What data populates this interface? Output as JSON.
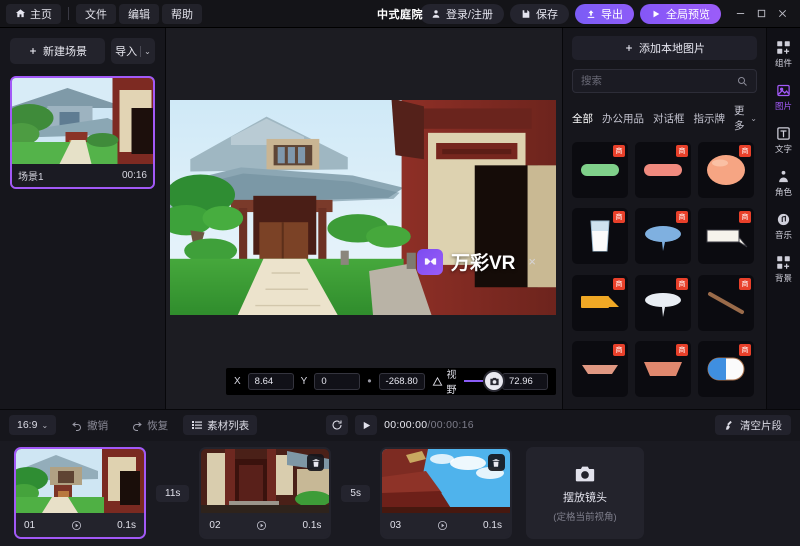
{
  "topbar": {
    "home": "主页",
    "menus": [
      "文件",
      "编辑",
      "帮助"
    ],
    "doc_title": "中式庭院",
    "login": "登录/注册",
    "save": "保存",
    "export": "导出",
    "preview": "全局预览",
    "accent": "#8b5cf6"
  },
  "scenes": {
    "new_scene": "新建场景",
    "import": "导入",
    "items": [
      {
        "name": "场景1",
        "duration": "00:16",
        "selected": true
      }
    ]
  },
  "stage": {
    "watermark": {
      "text": "万彩VR",
      "close": "×",
      "logo": "vr-logo-icon"
    },
    "transform": {
      "x_label": "X",
      "x_value": "8.64",
      "y_label": "Y",
      "y_value": "0",
      "z_value": "-268.80",
      "fov_label": "视野",
      "fov_value": "72.96"
    }
  },
  "assets": {
    "add_local": "添加本地图片",
    "search_placeholder": "搜索",
    "filters": [
      "全部",
      "办公用品",
      "对话框",
      "指示牌"
    ],
    "filter_active": "全部",
    "more": "更多",
    "badge_label": "商",
    "tiles": [
      {
        "shape": "green-rounded-bar",
        "color": "#7fd08a",
        "premium": true
      },
      {
        "shape": "salmon-rounded-bar",
        "color": "#f08a7e",
        "premium": true
      },
      {
        "shape": "peach-balloon",
        "color": "#f6a583",
        "premium": true
      },
      {
        "shape": "milk-glass",
        "color": "#f4f4f6",
        "premium": true
      },
      {
        "shape": "blue-speech-ellipse",
        "color": "#7fb0e0",
        "premium": true
      },
      {
        "shape": "white-rect-callout",
        "color": "#f6f3ec",
        "premium": true
      },
      {
        "shape": "orange-flag-callout",
        "color": "#f0a825",
        "premium": true
      },
      {
        "shape": "white-speech-ellipse",
        "color": "#e9eef4",
        "premium": true
      },
      {
        "shape": "brown-stick",
        "color": "#9a6b4a",
        "premium": true
      },
      {
        "shape": "salmon-trapezoid-thin",
        "color": "#e09882",
        "premium": true
      },
      {
        "shape": "salmon-trapezoid-thick",
        "color": "#e0886e",
        "premium": true
      },
      {
        "shape": "blue-white-capsule",
        "color": "#3f8fe0",
        "premium": true
      }
    ]
  },
  "rail": {
    "items": [
      {
        "label": "组件",
        "icon": "components-icon",
        "active": false
      },
      {
        "label": "图片",
        "icon": "image-icon",
        "active": true
      },
      {
        "label": "文字",
        "icon": "text-icon",
        "active": false
      },
      {
        "label": "角色",
        "icon": "character-icon",
        "active": false
      },
      {
        "label": "音乐",
        "icon": "music-icon",
        "active": false
      },
      {
        "label": "背景",
        "icon": "background-icon",
        "active": false
      }
    ]
  },
  "timeline": {
    "ratio": "16:9",
    "undo": "撤销",
    "redo": "恢复",
    "asset_list": "素材列表",
    "current_time": "00:00:00",
    "total_time": "00:00:16",
    "clear_clips": "清空片段",
    "clips": [
      {
        "index": "01",
        "duration": "0.1s",
        "selected": true,
        "deletable": false
      },
      {
        "index": "02",
        "duration": "0.1s",
        "selected": false,
        "deletable": true
      },
      {
        "index": "03",
        "duration": "0.1s",
        "selected": false,
        "deletable": true
      }
    ],
    "gaps": [
      "11s",
      "5s"
    ],
    "placeholder": {
      "title": "摆放镜头",
      "subtitle": "(定格当前视角)"
    }
  }
}
